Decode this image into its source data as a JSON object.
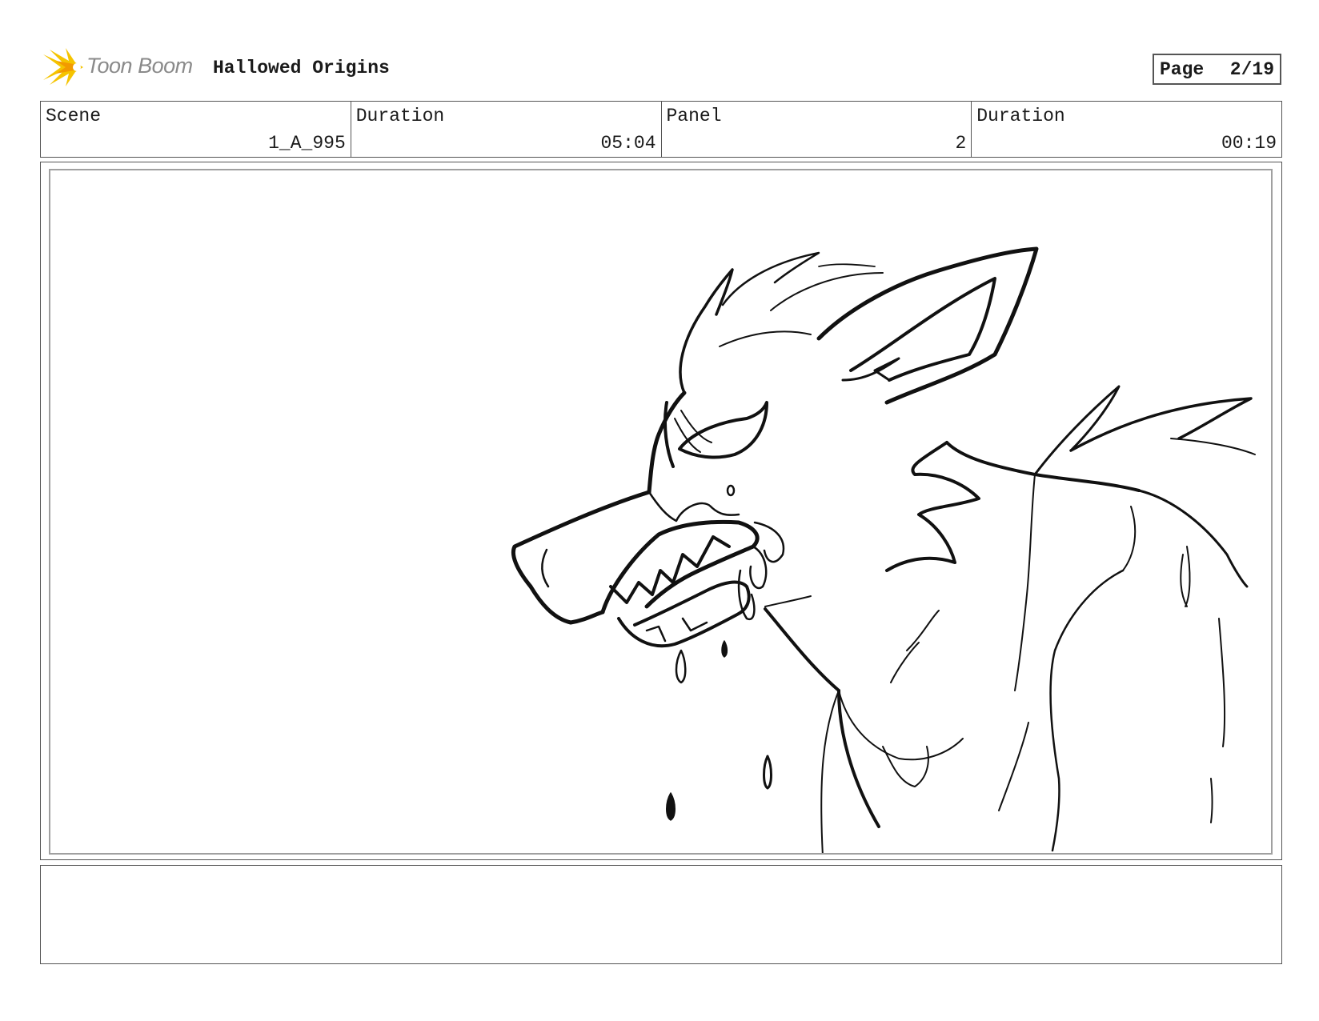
{
  "header": {
    "logo_text": "Toon Boom",
    "project_title": "Hallowed Origins",
    "page_label": "Page",
    "page_value": "2/19"
  },
  "info": {
    "scene_label": "Scene",
    "scene_value": "1_A_995",
    "scene_duration_label": "Duration",
    "scene_duration_value": "05:04",
    "panel_label": "Panel",
    "panel_value": "2",
    "panel_duration_label": "Duration",
    "panel_duration_value": "00:19"
  },
  "panel": {
    "drawing": "werewolf-sketch"
  },
  "notes": {
    "text": ""
  },
  "colors": {
    "logo_yellow": "#f5c400",
    "logo_orange": "#f29a00",
    "border": "#555555",
    "panel_border": "#a0a0a0"
  }
}
